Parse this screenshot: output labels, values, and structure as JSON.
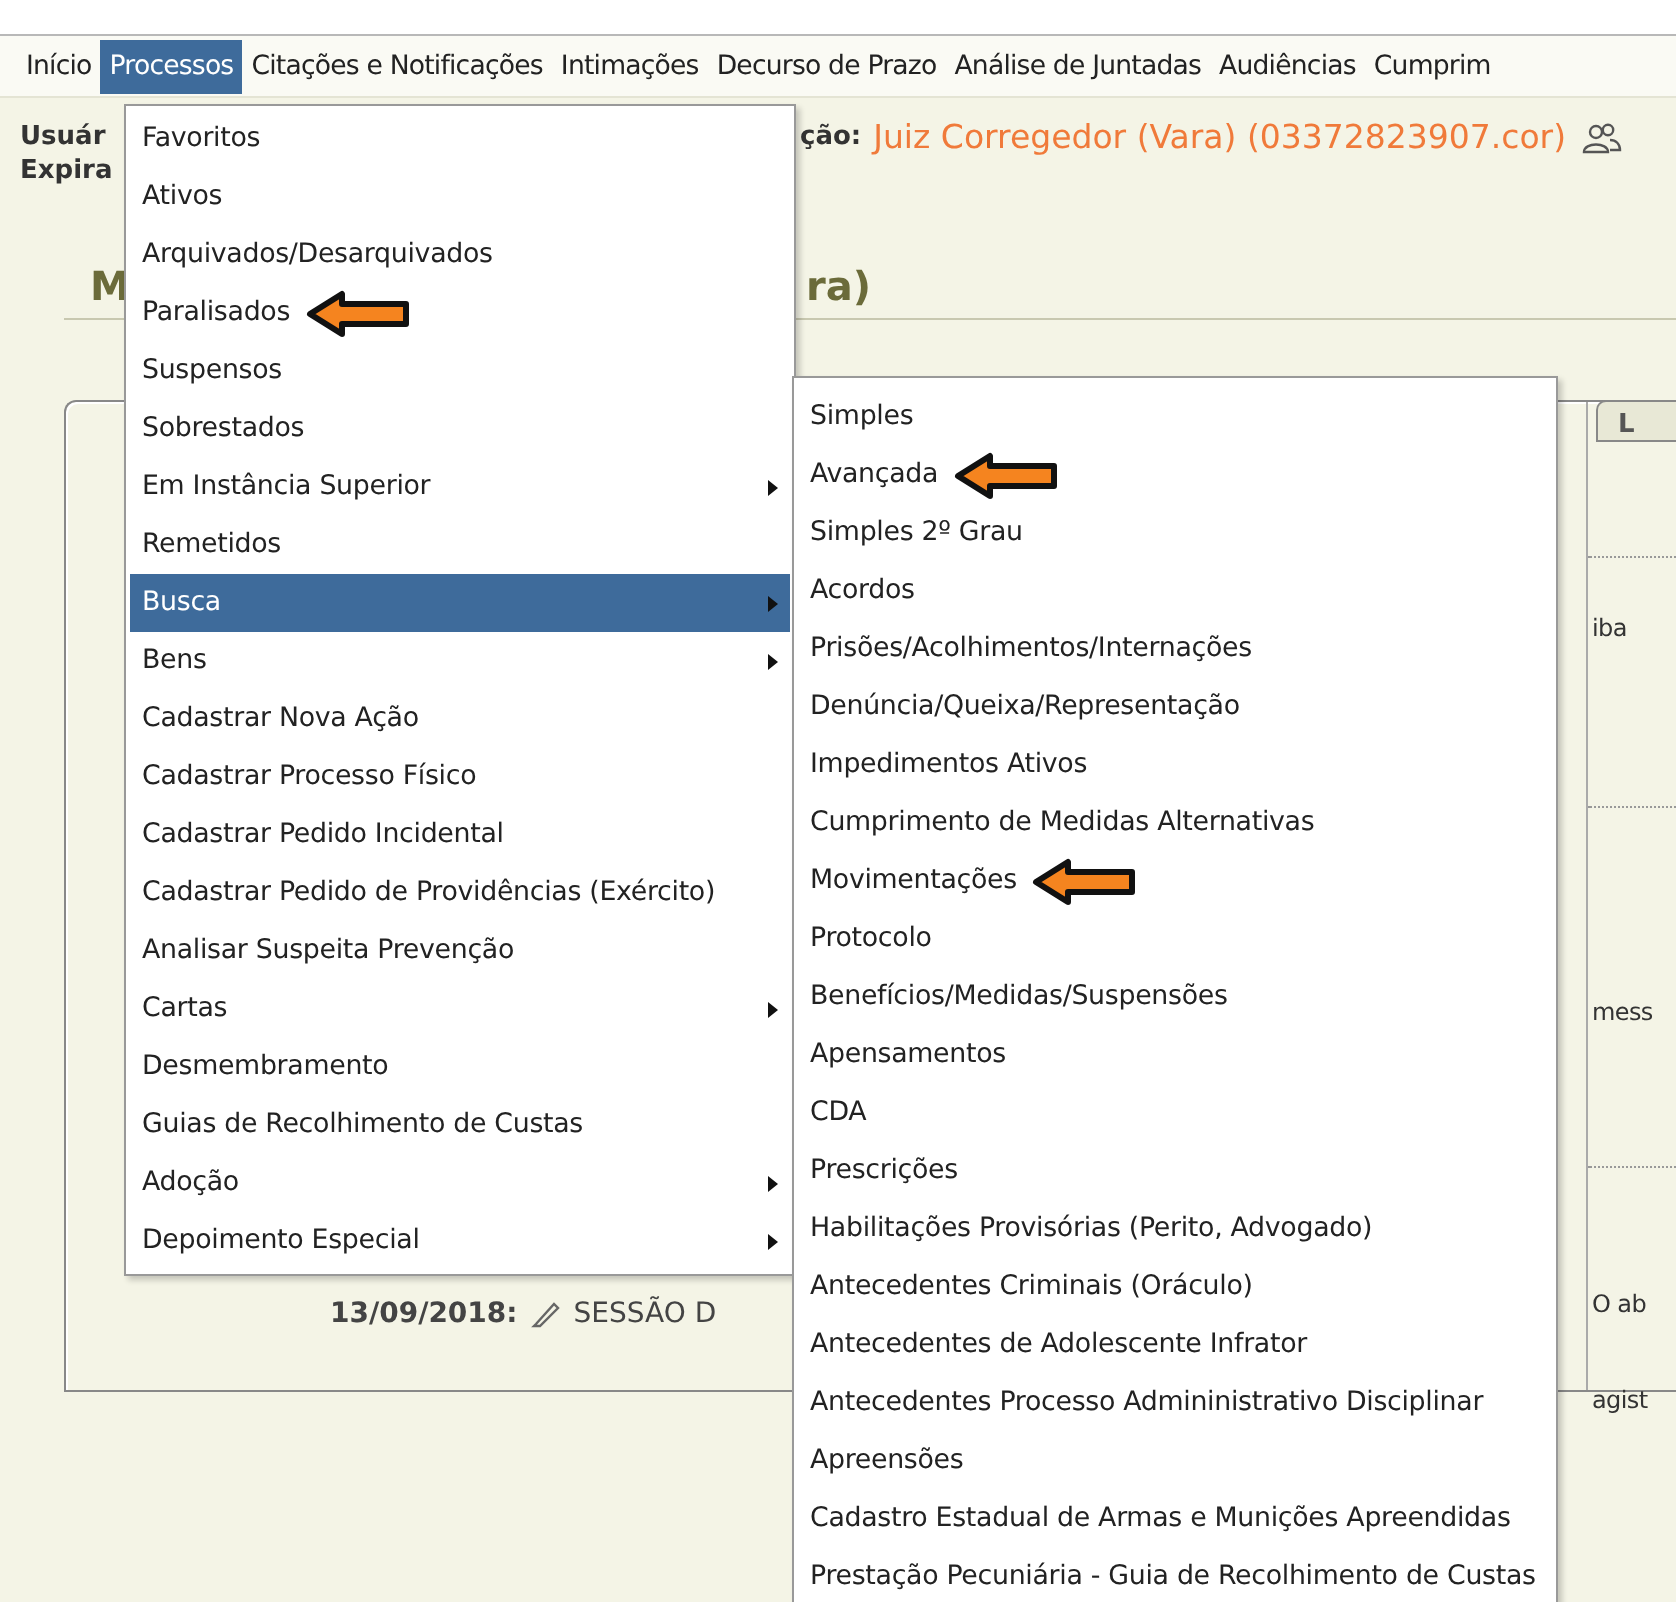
{
  "nav": {
    "items": [
      {
        "label": "Início",
        "selected": false
      },
      {
        "label": "Processos",
        "selected": true
      },
      {
        "label": "Citações e Notificações",
        "selected": false
      },
      {
        "label": "Intimações",
        "selected": false
      },
      {
        "label": "Decurso de Prazo",
        "selected": false
      },
      {
        "label": "Análise de Juntadas",
        "selected": false
      },
      {
        "label": "Audiências",
        "selected": false
      },
      {
        "label": "Cumprim",
        "selected": false
      }
    ]
  },
  "user_info": {
    "line_1_start": "Usuár",
    "profile_label": "ção:",
    "profile": "Juiz Corregedor (Vara) (03372823907.cor)",
    "line_2_start": "Expira"
  },
  "page_title": {
    "start": "M",
    "end": "ra)"
  },
  "panel": {
    "tab": "L",
    "right_fragments": [
      "iba",
      "mess",
      "O ab",
      "agist"
    ],
    "session": {
      "date": "13/09/2018:",
      "text": "SESSÃO D"
    }
  },
  "menu": {
    "items": [
      {
        "label": "Favoritos",
        "selected": false,
        "submenu": false,
        "arrow": false
      },
      {
        "label": "Ativos",
        "selected": false,
        "submenu": false,
        "arrow": false
      },
      {
        "label": "Arquivados/Desarquivados",
        "selected": false,
        "submenu": false,
        "arrow": false
      },
      {
        "label": "Paralisados",
        "selected": false,
        "submenu": false,
        "arrow": true
      },
      {
        "label": "Suspensos",
        "selected": false,
        "submenu": false,
        "arrow": false
      },
      {
        "label": "Sobrestados",
        "selected": false,
        "submenu": false,
        "arrow": false
      },
      {
        "label": "Em Instância Superior",
        "selected": false,
        "submenu": true,
        "arrow": false
      },
      {
        "label": "Remetidos",
        "selected": false,
        "submenu": false,
        "arrow": false
      },
      {
        "label": "Busca",
        "selected": true,
        "submenu": true,
        "arrow": false
      },
      {
        "label": "Bens",
        "selected": false,
        "submenu": true,
        "arrow": false
      },
      {
        "label": "Cadastrar Nova Ação",
        "selected": false,
        "submenu": false,
        "arrow": false
      },
      {
        "label": "Cadastrar Processo Físico",
        "selected": false,
        "submenu": false,
        "arrow": false
      },
      {
        "label": "Cadastrar Pedido Incidental",
        "selected": false,
        "submenu": false,
        "arrow": false
      },
      {
        "label": "Cadastrar Pedido de Providências (Exército)",
        "selected": false,
        "submenu": false,
        "arrow": false
      },
      {
        "label": "Analisar Suspeita Prevenção",
        "selected": false,
        "submenu": false,
        "arrow": false
      },
      {
        "label": "Cartas",
        "selected": false,
        "submenu": true,
        "arrow": false
      },
      {
        "label": "Desmembramento",
        "selected": false,
        "submenu": false,
        "arrow": false
      },
      {
        "label": "Guias de Recolhimento de Custas",
        "selected": false,
        "submenu": false,
        "arrow": false
      },
      {
        "label": "Adoção",
        "selected": false,
        "submenu": true,
        "arrow": false
      },
      {
        "label": "Depoimento Especial",
        "selected": false,
        "submenu": true,
        "arrow": false
      }
    ]
  },
  "submenu": {
    "items": [
      {
        "label": "Simples",
        "arrow": false
      },
      {
        "label": "Avançada",
        "arrow": true
      },
      {
        "label": "Simples 2º Grau",
        "arrow": false
      },
      {
        "label": "Acordos",
        "arrow": false
      },
      {
        "label": "Prisões/Acolhimentos/Internações",
        "arrow": false
      },
      {
        "label": "Denúncia/Queixa/Representação",
        "arrow": false
      },
      {
        "label": "Impedimentos Ativos",
        "arrow": false
      },
      {
        "label": "Cumprimento de Medidas Alternativas",
        "arrow": false
      },
      {
        "label": "Movimentações",
        "arrow": true
      },
      {
        "label": "Protocolo",
        "arrow": false
      },
      {
        "label": "Benefícios/Medidas/Suspensões",
        "arrow": false
      },
      {
        "label": "Apensamentos",
        "arrow": false
      },
      {
        "label": "CDA",
        "arrow": false
      },
      {
        "label": "Prescrições",
        "arrow": false
      },
      {
        "label": "Habilitações Provisórias (Perito, Advogado)",
        "arrow": false
      },
      {
        "label": "Antecedentes Criminais (Oráculo)",
        "arrow": false
      },
      {
        "label": "Antecedentes de Adolescente Infrator",
        "arrow": false
      },
      {
        "label": "Antecedentes Processo Admininistrativo Disciplinar",
        "arrow": false
      },
      {
        "label": "Apreensões",
        "arrow": false
      },
      {
        "label": "Cadastro Estadual de Armas e Munições Apreendidas",
        "arrow": false
      },
      {
        "label": "Prestação Pecuniária - Guia de Recolhimento de Custas",
        "arrow": false
      }
    ]
  }
}
